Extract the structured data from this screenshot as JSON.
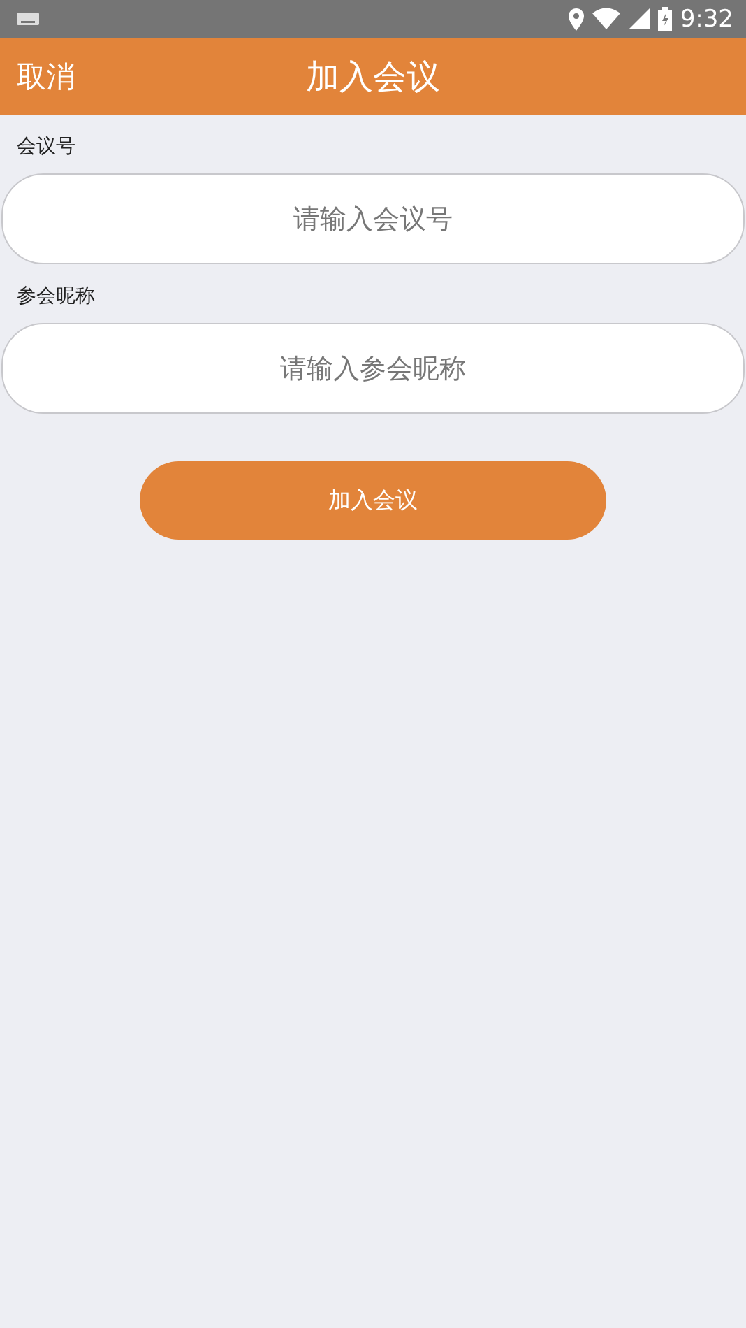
{
  "status_bar": {
    "time": "9:32"
  },
  "app_bar": {
    "cancel": "取消",
    "title": "加入会议"
  },
  "fields": [
    {
      "label": "会议号",
      "placeholder": "请输入会议号"
    },
    {
      "label": "参会昵称",
      "placeholder": "请输入参会昵称"
    }
  ],
  "submit": "加入会议"
}
